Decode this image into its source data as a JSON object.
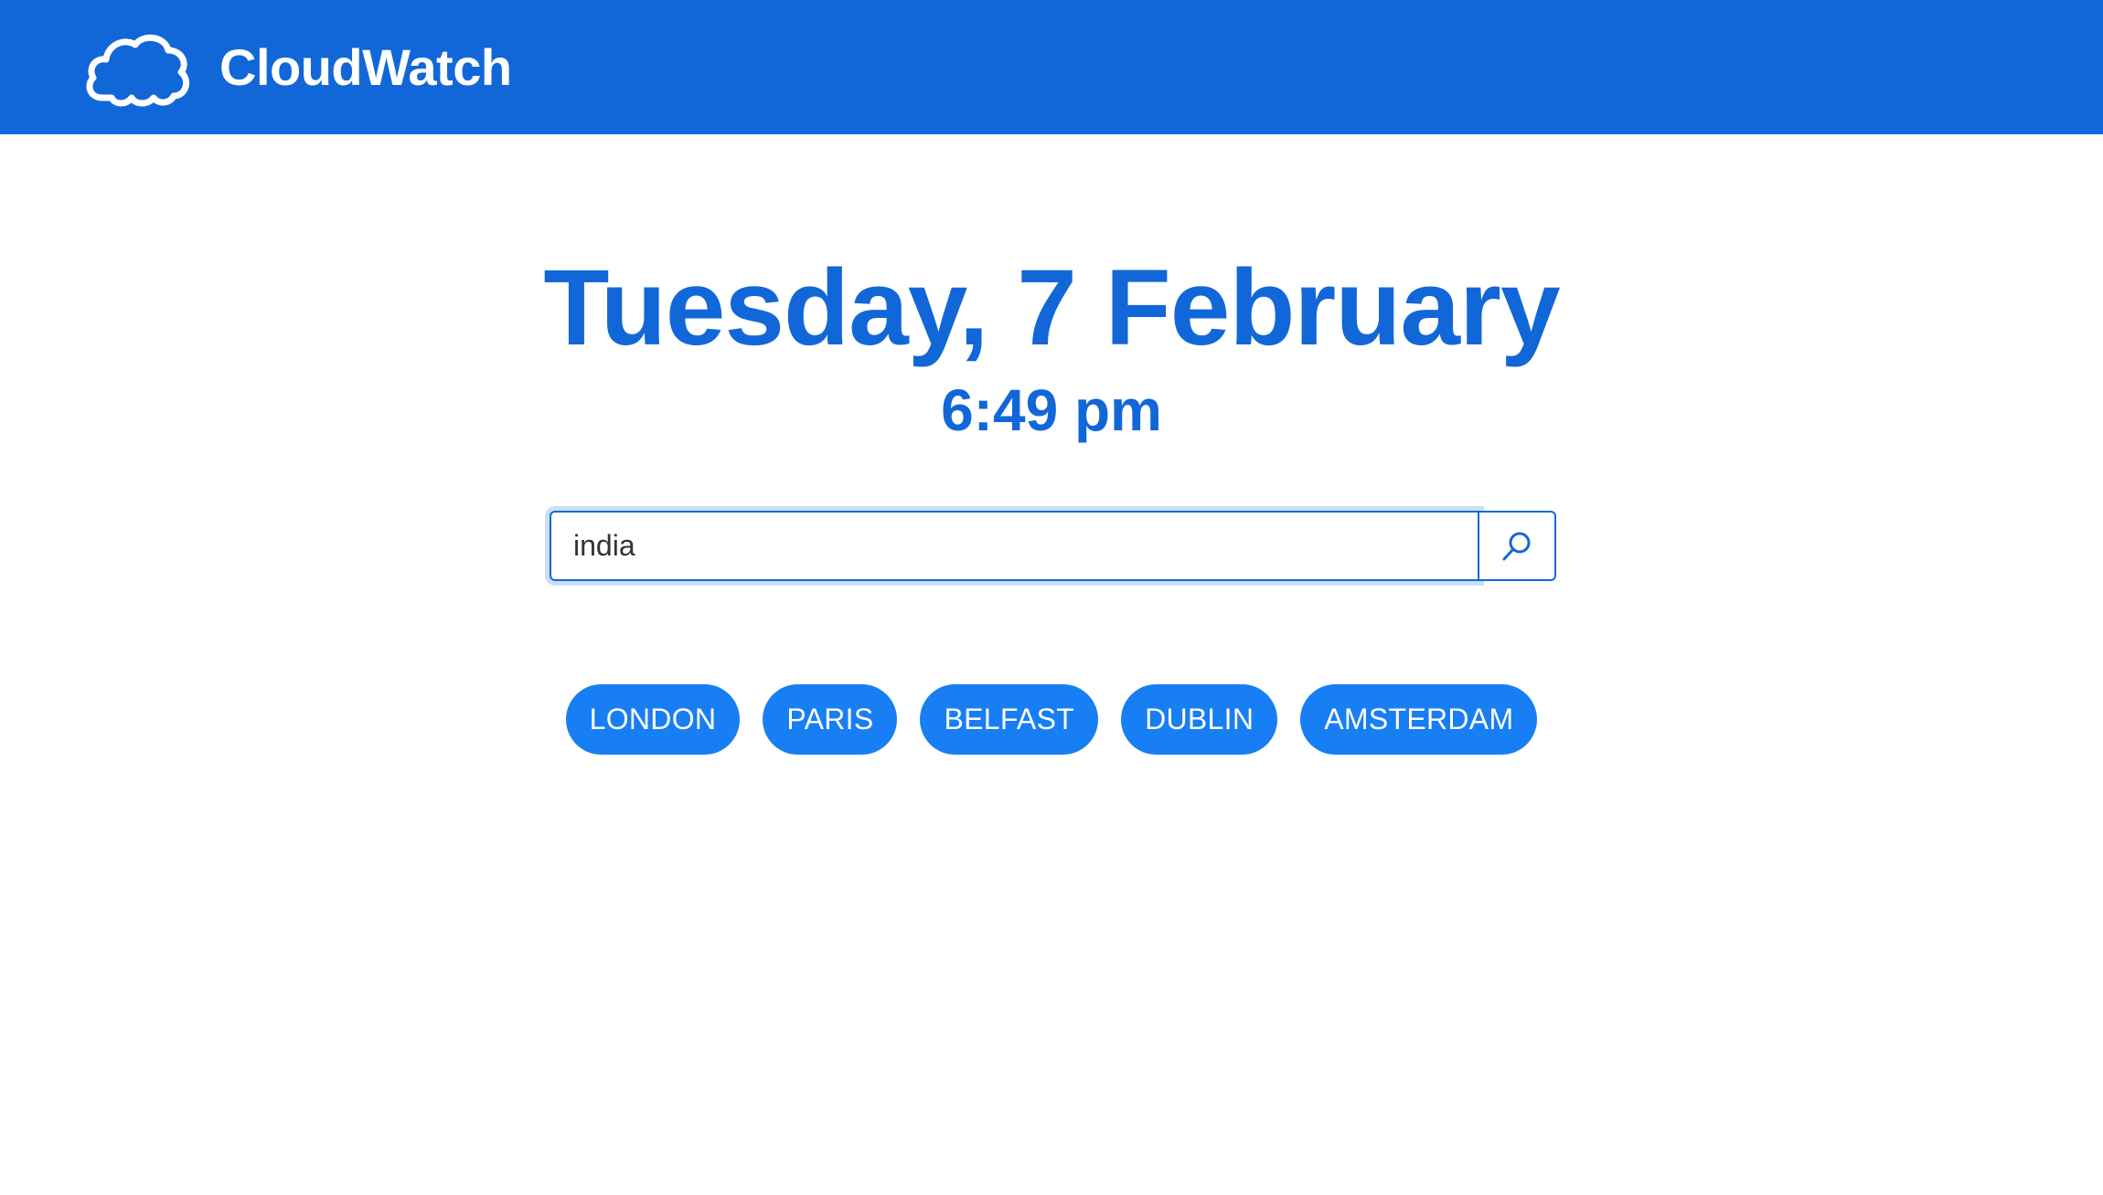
{
  "colors": {
    "primary": "#1267d8",
    "city_button": "#187ef3",
    "background": "#ffffff"
  },
  "header": {
    "logo_icon": "cloud-icon",
    "brand_name": "CloudWatch"
  },
  "main": {
    "date": "Tuesday, 7 February",
    "time": "6:49 pm"
  },
  "search": {
    "value": "india",
    "button_icon": "search-icon"
  },
  "cities": [
    {
      "label": "LONDON"
    },
    {
      "label": "PARIS"
    },
    {
      "label": "BELFAST"
    },
    {
      "label": "DUBLIN"
    },
    {
      "label": "AMSTERDAM"
    }
  ]
}
